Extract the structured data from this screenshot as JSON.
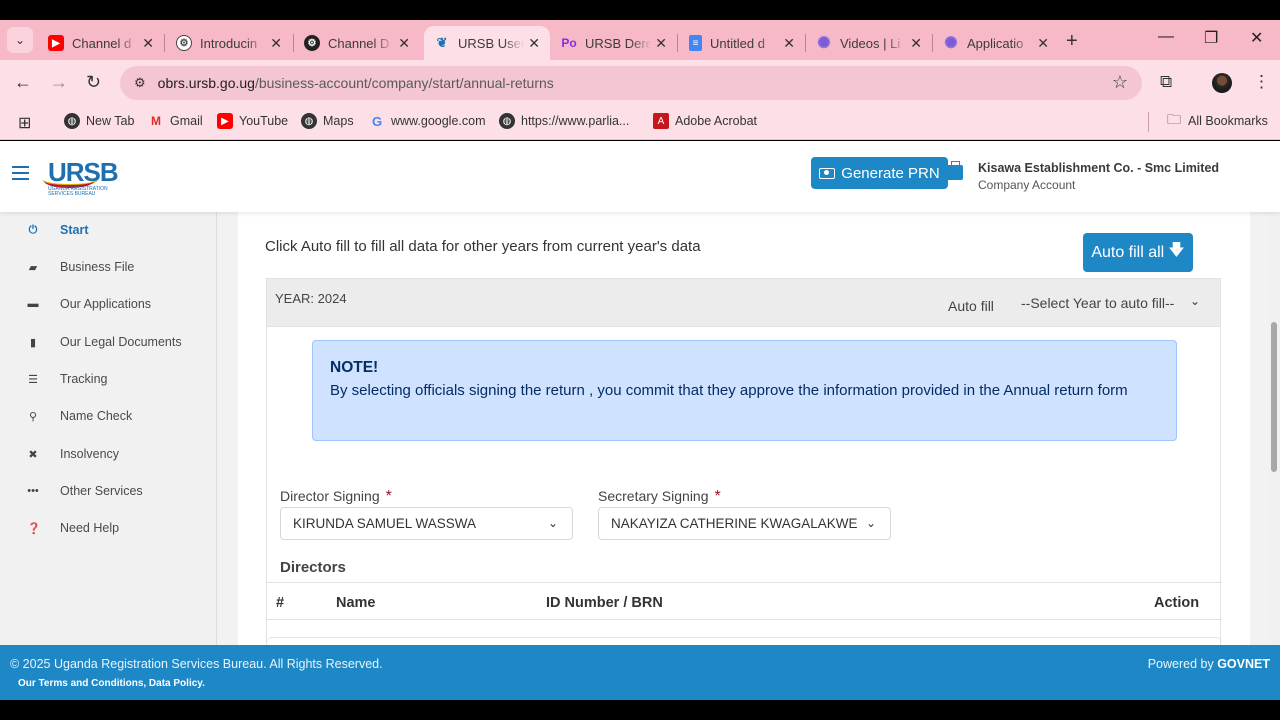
{
  "browser": {
    "tabs": [
      {
        "label": "Channel d",
        "icon": "youtube-icon",
        "color": "#ff0000"
      },
      {
        "label": "Introducin",
        "icon": "chatgpt-icon",
        "color": "#444444"
      },
      {
        "label": "Channel D",
        "icon": "chatgpt-icon",
        "color": "#222222"
      },
      {
        "label": "URSB User",
        "icon": "ursb-icon",
        "color": "#1e6fb0",
        "active": true
      },
      {
        "label": "URSB Dere",
        "icon": "po-icon",
        "color": "#8a2be2"
      },
      {
        "label": "Untitled d",
        "icon": "google-docs-icon",
        "color": "#4285f4"
      },
      {
        "label": "Videos | Li",
        "icon": "gear-icon",
        "color": "#7b5cd6"
      },
      {
        "label": "Applicatio",
        "icon": "gear-icon",
        "color": "#7b5cd6"
      }
    ],
    "url_domain": "obrs.ursb.go.ug",
    "url_path": "/business-account/company/start/annual-returns",
    "bookmarks": [
      {
        "label": "New Tab",
        "icon": "globe-icon"
      },
      {
        "label": "Gmail",
        "icon": "gmail-icon"
      },
      {
        "label": "YouTube",
        "icon": "youtube-icon"
      },
      {
        "label": "Maps",
        "icon": "globe-icon"
      },
      {
        "label": "www.google.com",
        "icon": "google-icon"
      },
      {
        "label": "https://www.parlia...",
        "icon": "globe-icon"
      },
      {
        "label": "Adobe Acrobat",
        "icon": "acrobat-icon"
      }
    ],
    "all_bookmarks": "All Bookmarks"
  },
  "header": {
    "logo_text": "URSB",
    "logo_sub": "UGANDA REGISTRATION SERVICES BUREAU",
    "generate_prn": "Generate PRN",
    "account_name": "Kisawa Establishment Co. - Smc Limited",
    "account_type": "Company Account"
  },
  "sidebar": {
    "items": [
      {
        "label": "Start",
        "icon": "power-icon",
        "active": true
      },
      {
        "label": "Business File",
        "icon": "briefcase-icon"
      },
      {
        "label": "Our Applications",
        "icon": "folder-icon"
      },
      {
        "label": "Our Legal Documents",
        "icon": "document-icon"
      },
      {
        "label": "Tracking",
        "icon": "list-icon"
      },
      {
        "label": "Name Check",
        "icon": "search-icon"
      },
      {
        "label": "Insolvency",
        "icon": "close-icon"
      },
      {
        "label": "Other Services",
        "icon": "ellipsis-icon"
      },
      {
        "label": "Need Help",
        "icon": "question-icon"
      }
    ]
  },
  "main": {
    "intro": "Click Auto fill to fill all data for other years from current year's data",
    "autofill_all": "Auto fill all",
    "year_label": "YEAR: 2024",
    "autofill_label": "Auto fill",
    "year_select_placeholder": "--Select Year to auto fill--",
    "note_title": "NOTE!",
    "note_body": "By selecting officials signing the return , you commit that they approve the information provided in the Annual return form",
    "director_label": "Director Signing",
    "director_value": "KIRUNDA SAMUEL WASSWA",
    "secretary_label": "Secretary Signing",
    "secretary_value": "NAKAYIZA CATHERINE KWAGALAKWE",
    "directors_title": "Directors",
    "table_headers": [
      "#",
      "Name",
      "ID Number / BRN",
      "Action"
    ]
  },
  "footer": {
    "copyright": "© 2025 Uganda Registration Services Bureau. All Rights Reserved.",
    "links": "Our Terms and Conditions, Data Policy.",
    "powered_by": "Powered by",
    "powered_brand": "GOVNET"
  },
  "colors": {
    "brand_blue": "#1e88c7",
    "note_bg": "#cfe2ff",
    "required": "#a0112b",
    "tabstrip": "#f7b9c7"
  }
}
